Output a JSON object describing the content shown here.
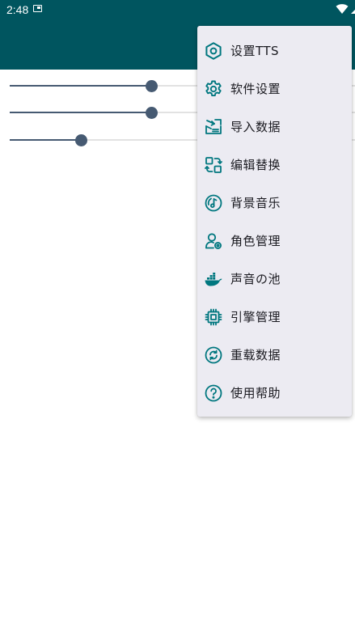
{
  "status_bar": {
    "time": "2:48"
  },
  "colors": {
    "header": "#00555f",
    "icon_tint": "#00777f",
    "menu_bg": "#ecebf2",
    "slider_active": "#465a72",
    "slider_track": "#e2e2e2"
  },
  "sliders": [
    {
      "fraction": 0.41
    },
    {
      "fraction": 0.41
    },
    {
      "fraction": 0.205
    }
  ],
  "menu": {
    "items": [
      {
        "label": "设置TTS",
        "icon": "hexagon-gear-icon"
      },
      {
        "label": "软件设置",
        "icon": "gear-icon"
      },
      {
        "label": "导入数据",
        "icon": "import-icon"
      },
      {
        "label": "编辑替换",
        "icon": "replace-icon"
      },
      {
        "label": "背景音乐",
        "icon": "music-disc-icon"
      },
      {
        "label": "角色管理",
        "icon": "person-settings-icon"
      },
      {
        "label": "声音の池",
        "icon": "docker-whale-icon"
      },
      {
        "label": "引擎管理",
        "icon": "chip-icon"
      },
      {
        "label": "重载数据",
        "icon": "reload-icon"
      },
      {
        "label": "使用帮助",
        "icon": "help-icon"
      }
    ]
  }
}
